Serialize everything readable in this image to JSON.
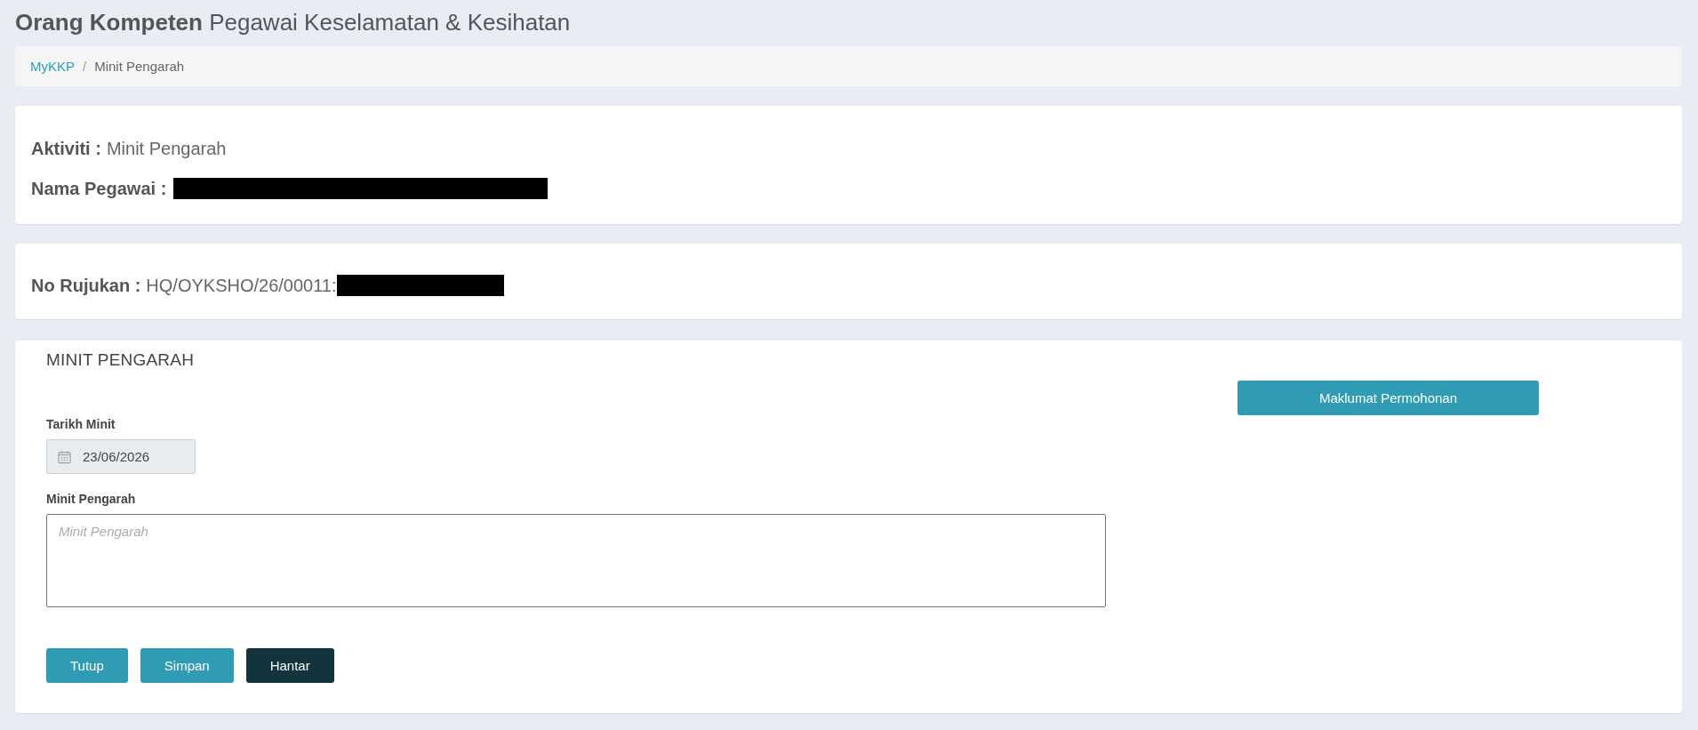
{
  "page_header": {
    "title": "**Orang Kompeten** Pegawai Keselamatan & Kesihatan"
  },
  "breadcrumb": {
    "separator": "/",
    "items": [
      {
        "label": "MyKKP",
        "kind": "link"
      },
      {
        "label": "Minit Pengarah",
        "kind": "current"
      }
    ]
  },
  "activity_card": {
    "fields": [
      {
        "label": "Aktiviti :",
        "value": "Minit Pengarah",
        "redacted": false
      },
      {
        "label": "Nama Pegawai :",
        "redacted": true
      }
    ]
  },
  "reference_card": {
    "fields": [
      {
        "label": "No Rujukan :",
        "value": "HQ/OYKSHO/26/00011:",
        "redacted": true
      }
    ]
  },
  "minute_form": {
    "heading": "MINIT PENGARAH",
    "side_button": {
      "label": "Maklumat Permohonan",
      "kind": "info"
    },
    "date_field": {
      "label": "Tarikh Minit",
      "value": "23/06/2026",
      "disabled": true
    },
    "minute_field": {
      "label": "Minit Pengarah",
      "placeholder": "Minit Pengarah"
    },
    "buttons": [
      {
        "label": "Tutup",
        "kind": "info"
      },
      {
        "label": "Simpan",
        "kind": "info"
      },
      {
        "label": "Hantar",
        "kind": "dark"
      }
    ]
  }
}
